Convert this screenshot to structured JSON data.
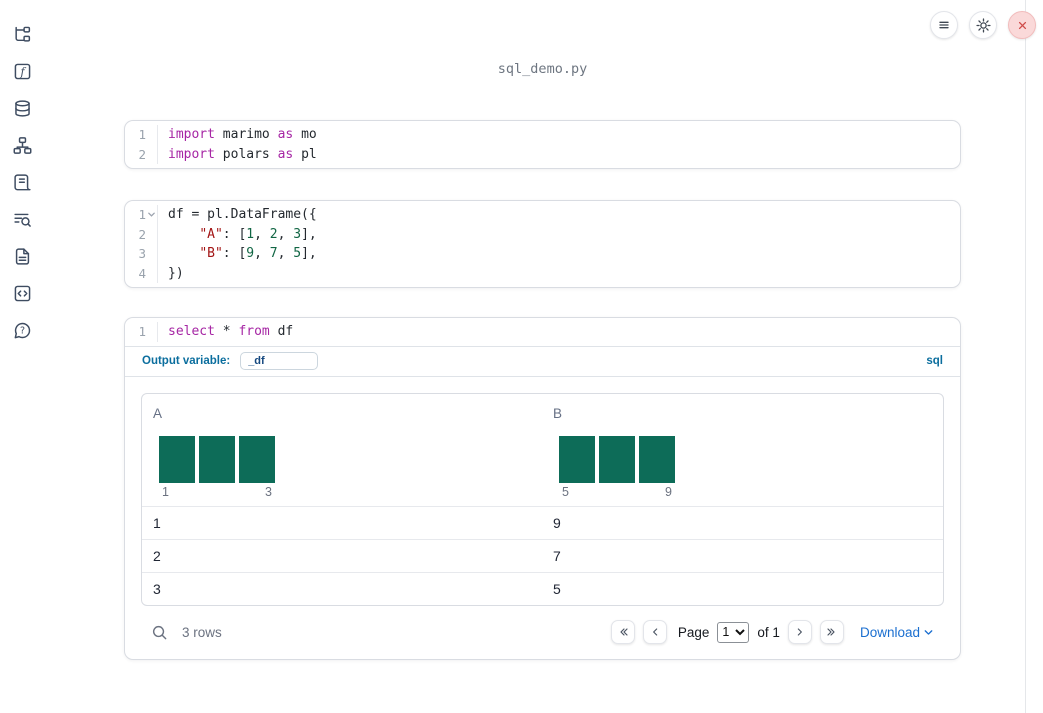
{
  "page": {
    "title": "sql_demo.py"
  },
  "topbar": {
    "buttons": [
      {
        "name": "notebook-actions",
        "icon": "menu-icon"
      },
      {
        "name": "settings",
        "icon": "gear-icon"
      },
      {
        "name": "shutdown",
        "icon": "close-icon"
      }
    ]
  },
  "sidebar": {
    "items": [
      {
        "name": "file-explorer",
        "icon": "file-tree-icon"
      },
      {
        "name": "variables",
        "icon": "function-square-icon"
      },
      {
        "name": "data-sources",
        "icon": "database-icon"
      },
      {
        "name": "dependency-graph",
        "icon": "dependency-graph-icon"
      },
      {
        "name": "logs",
        "icon": "scroll-icon"
      },
      {
        "name": "snippets",
        "icon": "list-search-icon"
      },
      {
        "name": "documentation",
        "icon": "file-text-icon"
      },
      {
        "name": "scratchpad",
        "icon": "code-box-icon"
      },
      {
        "name": "help",
        "icon": "help-bubble-icon"
      }
    ]
  },
  "cells": [
    {
      "lines": [
        {
          "no": "1",
          "tokens": [
            {
              "c": "kw",
              "t": "import"
            },
            {
              "c": "pl",
              "t": " marimo "
            },
            {
              "c": "kw",
              "t": "as"
            },
            {
              "c": "pl",
              "t": " mo"
            }
          ]
        },
        {
          "no": "2",
          "tokens": [
            {
              "c": "kw",
              "t": "import"
            },
            {
              "c": "pl",
              "t": " polars "
            },
            {
              "c": "kw",
              "t": "as"
            },
            {
              "c": "pl",
              "t": " pl"
            }
          ]
        }
      ]
    },
    {
      "lines": [
        {
          "no": "1",
          "fold": true,
          "tokens": [
            {
              "c": "pl",
              "t": "df = pl.DataFrame({"
            }
          ]
        },
        {
          "no": "2",
          "tokens": [
            {
              "c": "pl",
              "t": "    "
            },
            {
              "c": "str",
              "t": "\"A\""
            },
            {
              "c": "pl",
              "t": ": ["
            },
            {
              "c": "num",
              "t": "1"
            },
            {
              "c": "pl",
              "t": ", "
            },
            {
              "c": "num",
              "t": "2"
            },
            {
              "c": "pl",
              "t": ", "
            },
            {
              "c": "num",
              "t": "3"
            },
            {
              "c": "pl",
              "t": "],"
            }
          ]
        },
        {
          "no": "3",
          "tokens": [
            {
              "c": "pl",
              "t": "    "
            },
            {
              "c": "str",
              "t": "\"B\""
            },
            {
              "c": "pl",
              "t": ": ["
            },
            {
              "c": "num",
              "t": "9"
            },
            {
              "c": "pl",
              "t": ", "
            },
            {
              "c": "num",
              "t": "7"
            },
            {
              "c": "pl",
              "t": ", "
            },
            {
              "c": "num",
              "t": "5"
            },
            {
              "c": "pl",
              "t": "],"
            }
          ]
        },
        {
          "no": "4",
          "tokens": [
            {
              "c": "pl",
              "t": "})"
            }
          ]
        }
      ]
    },
    {
      "lines": [
        {
          "no": "1",
          "tokens": [
            {
              "c": "kw",
              "t": "select"
            },
            {
              "c": "pl",
              "t": " * "
            },
            {
              "c": "kw",
              "t": "from"
            },
            {
              "c": "pl",
              "t": " df"
            }
          ]
        }
      ],
      "output_variable_label": "Output variable:",
      "output_variable_value": "_df",
      "language_badge": "sql"
    }
  ],
  "table": {
    "columns": [
      {
        "label": "A",
        "histogram": {
          "bars": [
            1,
            1,
            1
          ],
          "min_label": "1",
          "max_label": "3"
        }
      },
      {
        "label": "B",
        "histogram": {
          "bars": [
            1,
            1,
            1
          ],
          "min_label": "5",
          "max_label": "9"
        }
      }
    ],
    "rows": [
      [
        "1",
        "9"
      ],
      [
        "2",
        "7"
      ],
      [
        "3",
        "5"
      ]
    ],
    "footer": {
      "row_count": "3 rows",
      "page_label": "Page",
      "page_value": "1",
      "of_label": "of 1",
      "download_label": "Download"
    }
  },
  "colors": {
    "histogram_teal": "#0d6c58",
    "keyword_purple": "#a626a4",
    "string_red": "#a31515",
    "number_green": "#116644",
    "label_blue": "#0b6e9e",
    "link_blue": "#1b6fd0",
    "danger_red": "#cf4c4a"
  }
}
